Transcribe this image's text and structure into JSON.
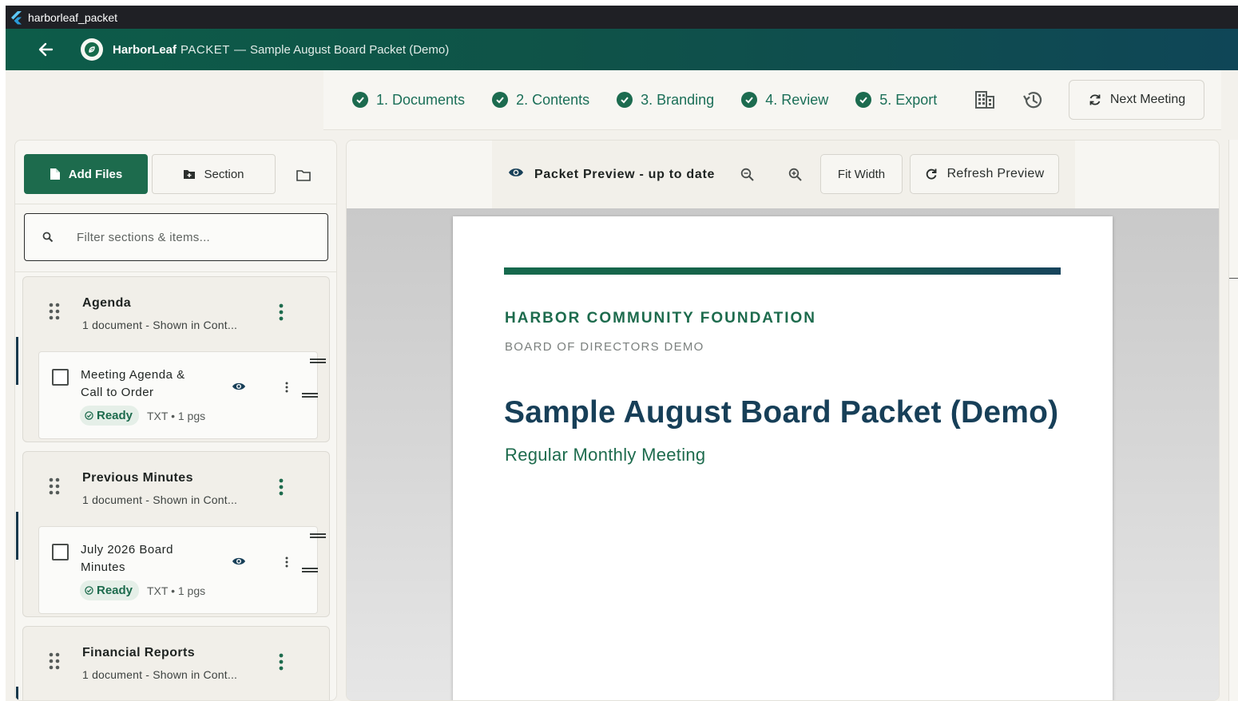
{
  "window": {
    "title": "harborleaf_packet"
  },
  "appbar": {
    "brand": "HarborLeaf",
    "brand_sub": "PACKET",
    "separator": "—",
    "document_title": "Sample August Board Packet (Demo)"
  },
  "steps": [
    {
      "label": "1. Documents",
      "done": true
    },
    {
      "label": "2. Contents",
      "done": true
    },
    {
      "label": "3. Branding",
      "done": true
    },
    {
      "label": "4. Review",
      "done": true
    },
    {
      "label": "5. Export",
      "done": true
    }
  ],
  "toolbar": {
    "organization_icon": "building-icon",
    "history_icon": "history-icon",
    "next_meeting_label": "Next Meeting"
  },
  "sidebar": {
    "add_files_label": "Add Files",
    "section_label": "Section",
    "filter_placeholder": "Filter sections & items...",
    "sections": [
      {
        "title": "Agenda",
        "meta": "1 document - Shown in Cont...",
        "items": [
          {
            "name": "Meeting Agenda & Call to Order",
            "status": "Ready",
            "file_meta": "TXT • 1 pgs"
          }
        ]
      },
      {
        "title": "Previous Minutes",
        "meta": "1 document - Shown in Cont...",
        "items": [
          {
            "name": "July 2026 Board Minutes",
            "status": "Ready",
            "file_meta": "TXT • 1 pgs"
          }
        ]
      },
      {
        "title": "Financial Reports",
        "meta": "1 document - Shown in Cont...",
        "items": []
      }
    ]
  },
  "preview": {
    "status": "Packet Preview - up to date",
    "fit_width_label": "Fit Width",
    "refresh_label": "Refresh Preview",
    "page": {
      "organization": "HARBOR COMMUNITY FOUNDATION",
      "subtitle": "BOARD OF DIRECTORS DEMO",
      "title": "Sample August Board Packet (Demo)",
      "meeting_type": "Regular Monthly Meeting"
    }
  },
  "colors": {
    "primary_green": "#1d6b4d",
    "navy": "#173f58",
    "appbar_start": "#0d5c49",
    "appbar_end": "#0f4657"
  }
}
